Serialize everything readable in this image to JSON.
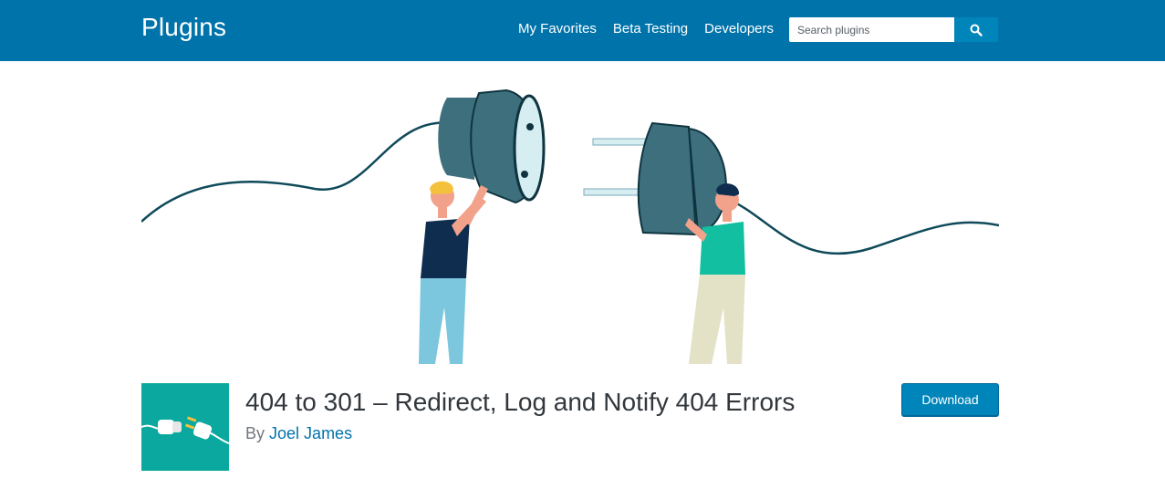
{
  "header": {
    "site_title": "Plugins",
    "nav": [
      "My Favorites",
      "Beta Testing",
      "Developers"
    ],
    "search_placeholder": "Search plugins"
  },
  "plugin": {
    "title": "404 to 301 – Redirect, Log and Notify 404 Errors",
    "by_label": "By",
    "author": "Joel James",
    "download_label": "Download"
  },
  "colors": {
    "header_bg": "#0073aa",
    "button": "#0085ba",
    "icon_bg": "#0aa89e",
    "plug": "#3d6f7c",
    "cable": "#0f4a5a"
  }
}
